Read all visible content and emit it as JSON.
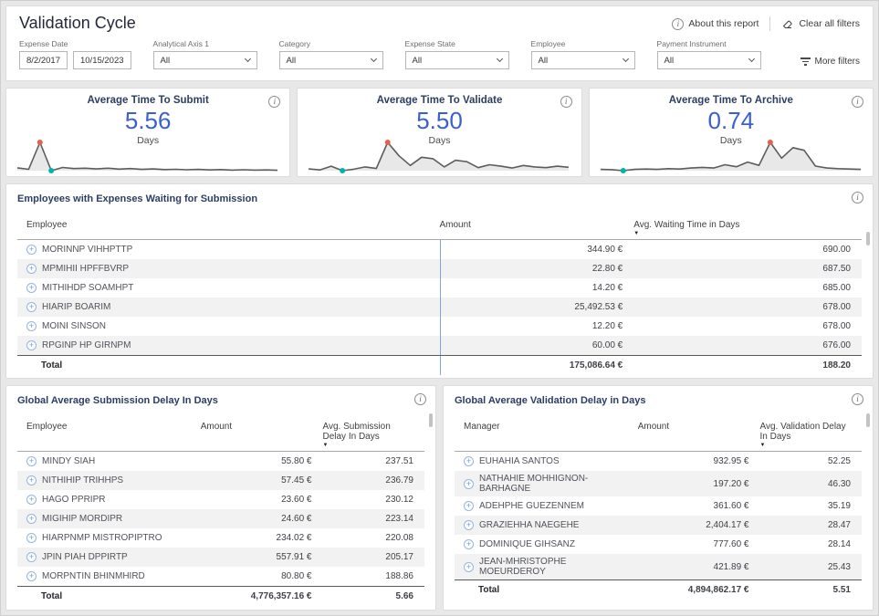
{
  "colors": {
    "kpi_value": "#3a5fd1",
    "section_title": "#2c3e63",
    "max_dot": "#e8604c",
    "min_dot": "#00b2a9",
    "row_alt": "#f2f2f2",
    "table_divider": "#7da7d8",
    "spark_line": "#5c5c5c"
  },
  "header": {
    "title": "Validation Cycle",
    "about_label": "About this report",
    "clear_filters_label": "Clear all filters",
    "more_filters_label": "More filters"
  },
  "filters": {
    "date": {
      "label": "Expense Date",
      "from": "8/2/2017",
      "to": "10/15/2023"
    },
    "dropdowns": [
      {
        "label": "Analytical Axis 1",
        "value": "All"
      },
      {
        "label": "Category",
        "value": "All"
      },
      {
        "label": "Expense State",
        "value": "All"
      },
      {
        "label": "Employee",
        "value": "All"
      },
      {
        "label": "Payment Instrument",
        "value": "All"
      }
    ]
  },
  "kpis": [
    {
      "title": "Average Time To Submit",
      "value": "5.56",
      "unit": "Days",
      "spark": [
        1.6,
        1.2,
        8.8,
        0.8,
        1.7,
        1.4,
        1.5,
        1.3,
        1.5,
        1.25,
        1.4,
        1.15,
        1.3,
        1.1,
        1.2,
        1.05,
        1.15,
        1.0,
        1.1,
        0.95,
        1.05,
        0.95,
        1.0,
        0.9
      ]
    },
    {
      "title": "Average Time To Validate",
      "value": "5.50",
      "unit": "Days",
      "spark": [
        1.5,
        1.2,
        2.2,
        1.0,
        1.4,
        2.0,
        1.6,
        8.6,
        5.0,
        2.4,
        4.6,
        4.2,
        2.0,
        3.8,
        3.4,
        1.8,
        2.6,
        2.2,
        1.7,
        2.4,
        2.0,
        1.8,
        2.2,
        1.9
      ]
    },
    {
      "title": "Average Time To Archive",
      "value": "0.74",
      "unit": "Days",
      "spark": [
        0.5,
        0.45,
        0.3,
        0.5,
        0.55,
        0.5,
        0.6,
        0.55,
        0.7,
        0.8,
        0.7,
        1.2,
        0.9,
        1.6,
        1.1,
        4.6,
        2.2,
        3.8,
        3.4,
        1.0,
        0.7,
        0.6,
        0.55,
        0.5
      ]
    }
  ],
  "waiting_table": {
    "title": "Employees with Expenses Waiting for Submission",
    "columns": {
      "c1": "Employee",
      "c2": "Amount",
      "c3": "Avg. Waiting Time in Days"
    },
    "rows": [
      {
        "name": "MORINNP VIHHPTTP",
        "amount": "344.90 €",
        "value": "690.00"
      },
      {
        "name": "MPMIHII HPFFBVRP",
        "amount": "22.80 €",
        "value": "687.50"
      },
      {
        "name": "MITHIHDP SOAMHPT",
        "amount": "14.20 €",
        "value": "685.00"
      },
      {
        "name": "HIARIP BOARIM",
        "amount": "25,492.53 €",
        "value": "678.00"
      },
      {
        "name": "MOINI SINSON",
        "amount": "12.20 €",
        "value": "678.00"
      },
      {
        "name": "RPGINP HP GIRNPM",
        "amount": "60.00 €",
        "value": "676.00"
      }
    ],
    "total": {
      "label": "Total",
      "amount": "175,086.64 €",
      "value": "188.20"
    }
  },
  "submission_table": {
    "title": "Global Average Submission Delay In Days",
    "columns": {
      "c1": "Employee",
      "c2": "Amount",
      "c3": "Avg. Submission Delay In Days"
    },
    "rows": [
      {
        "name": "MINDY SIAH",
        "amount": "55.80 €",
        "value": "237.51"
      },
      {
        "name": "NITHIHIP TRIHHPS",
        "amount": "57.45 €",
        "value": "236.79"
      },
      {
        "name": "HAGO PPRIPR",
        "amount": "23.60 €",
        "value": "230.12"
      },
      {
        "name": "MIGIHIP MORDIPR",
        "amount": "24.60 €",
        "value": "223.14"
      },
      {
        "name": "HIARPNMP MISTROPIPTRO",
        "amount": "234.02 €",
        "value": "220.08"
      },
      {
        "name": "JPIN PIAH DPPIRTP",
        "amount": "557.91 €",
        "value": "205.17"
      },
      {
        "name": "MORPNTIN BHINMHIRD",
        "amount": "80.80 €",
        "value": "188.86"
      }
    ],
    "total": {
      "label": "Total",
      "amount": "4,776,357.16 €",
      "value": "5.66"
    }
  },
  "validation_table": {
    "title": "Global Average Validation Delay in Days",
    "columns": {
      "c1": "Manager",
      "c2": "Amount",
      "c3": "Avg. Validation Delay In Days"
    },
    "rows": [
      {
        "name": "EUHAHIA SANTOS",
        "amount": "932.95 €",
        "value": "52.25"
      },
      {
        "name": "NATHAHIE MOHHIGNON-BARHAGNE",
        "amount": "197.20 €",
        "value": "46.30"
      },
      {
        "name": "ADEHPHE GUEZENNEM",
        "amount": "361.60 €",
        "value": "35.19"
      },
      {
        "name": "GRAZIEHHA NAEGEHE",
        "amount": "2,404.17 €",
        "value": "28.47"
      },
      {
        "name": "DOMINIQUE GIHSANZ",
        "amount": "777.60 €",
        "value": "28.14"
      },
      {
        "name": "JEAN-MHRISTOPHE MOEURDEROY",
        "amount": "421.89 €",
        "value": "25.43"
      }
    ],
    "total": {
      "label": "Total",
      "amount": "4,894,862.17 €",
      "value": "5.51"
    }
  }
}
